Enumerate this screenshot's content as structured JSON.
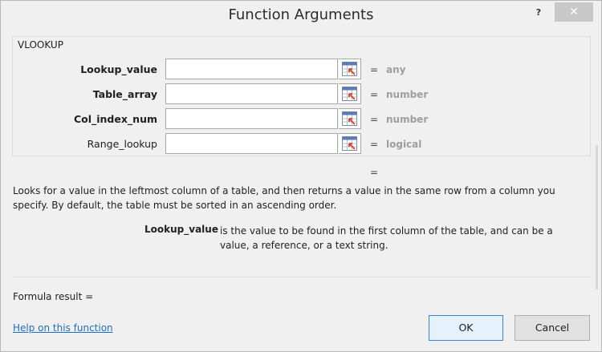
{
  "window": {
    "title": "Function Arguments",
    "help_label": "?",
    "close_label": "✕"
  },
  "function_group": {
    "name": "VLOOKUP",
    "arguments": [
      {
        "label": "Lookup_value",
        "value": "",
        "type_hint": "any",
        "required": true
      },
      {
        "label": "Table_array",
        "value": "",
        "type_hint": "number",
        "required": true
      },
      {
        "label": "Col_index_num",
        "value": "",
        "type_hint": "number",
        "required": true
      },
      {
        "label": "Range_lookup",
        "value": "",
        "type_hint": "logical",
        "required": false
      }
    ],
    "equals_sign": "="
  },
  "result_preview": "=",
  "description": "Looks for a value in the leftmost column of a table, and then returns a value in the same row from a column you specify. By default, the table must be sorted in an ascending order.",
  "argument_help": {
    "name": "Lookup_value",
    "text": "is the value to be found in the first column of the table, and can be a value, a reference, or a text string."
  },
  "formula_result_label": "Formula result =",
  "help_link": "Help on this function",
  "buttons": {
    "ok": "OK",
    "cancel": "Cancel"
  },
  "icons": {
    "help": "help-icon",
    "close": "close-icon",
    "range_selector": "range-selector-icon"
  },
  "colors": {
    "link": "#1a6fc2",
    "ok_border": "#3b86d1",
    "type_hint": "#9e9e9e",
    "range_arrow": "#d9412b"
  }
}
